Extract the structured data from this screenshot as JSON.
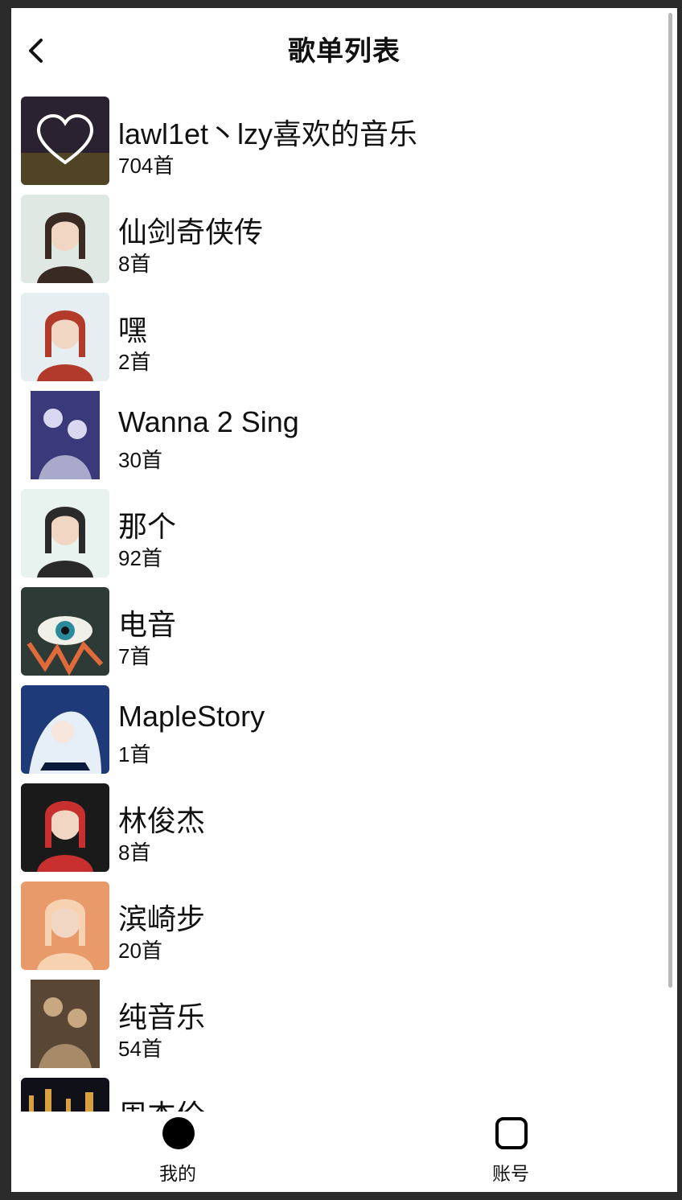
{
  "header": {
    "title": "歌单列表",
    "back_icon": "chevron-left-icon"
  },
  "playlists": [
    {
      "name": "lawl1et丶lzy喜欢的音乐",
      "count": "704首",
      "cover": "liked-heart-cover",
      "colors": [
        "#2a2230",
        "#6a5a20"
      ]
    },
    {
      "name": "仙剑奇侠传",
      "count": "8首",
      "cover": "portrait-cover",
      "colors": [
        "#dfe8e2",
        "#3a2a24"
      ]
    },
    {
      "name": "嘿",
      "count": "2首",
      "cover": "portrait-cover",
      "colors": [
        "#e6eef2",
        "#b23a2a"
      ]
    },
    {
      "name": "Wanna 2 Sing",
      "count": "30首",
      "cover": "poster-cover",
      "colors": [
        "#3a3a7a",
        "#d8d8f0"
      ]
    },
    {
      "name": "那个",
      "count": "92首",
      "cover": "portrait-cover",
      "colors": [
        "#e8f2ee",
        "#2a2a2a"
      ]
    },
    {
      "name": "电音",
      "count": "7首",
      "cover": "eye-art-cover",
      "colors": [
        "#2e3a36",
        "#e06a3a"
      ]
    },
    {
      "name": "MapleStory",
      "count": "1首",
      "cover": "anime-cover",
      "colors": [
        "#1e3a78",
        "#e6eef8"
      ]
    },
    {
      "name": "林俊杰",
      "count": "8首",
      "cover": "portrait-cover",
      "colors": [
        "#1a1a1a",
        "#c83030"
      ]
    },
    {
      "name": "滨崎步",
      "count": "20首",
      "cover": "portrait-cover",
      "colors": [
        "#e89a6a",
        "#f6d2b0"
      ]
    },
    {
      "name": "纯音乐",
      "count": "54首",
      "cover": "poster-cover",
      "colors": [
        "#5a4634",
        "#c8a880"
      ]
    },
    {
      "name": "周杰伦",
      "count": "",
      "cover": "city-night-cover",
      "colors": [
        "#101018",
        "#d8a040"
      ]
    }
  ],
  "tabs": [
    {
      "label": "我的",
      "icon": "filled-circle-icon",
      "active": true
    },
    {
      "label": "账号",
      "icon": "rounded-square-icon",
      "active": false
    }
  ]
}
